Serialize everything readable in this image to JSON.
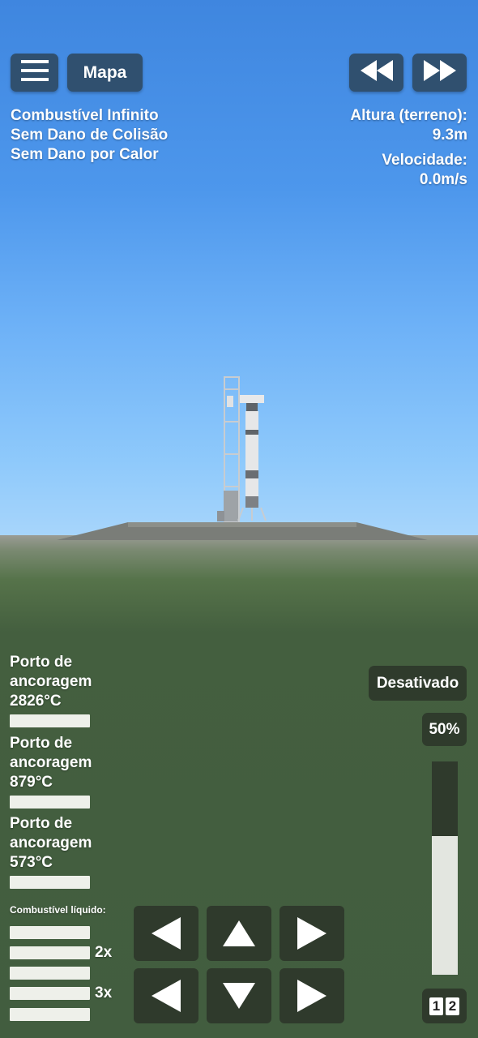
{
  "toolbar": {
    "menu_icon": "hamburger-menu-icon",
    "map_label": "Mapa",
    "rewind_icon": "rewind-icon",
    "fast_forward_icon": "fast-forward-icon"
  },
  "cheats": [
    "Combustível Infinito",
    "Sem Dano de Colisão",
    "Sem Dano por Calor"
  ],
  "telemetry": {
    "altitude_label": "Altura (terreno):",
    "altitude_value": "9.3m",
    "velocity_label": "Velocidade:",
    "velocity_value": "0.0m/s"
  },
  "docking_ports": [
    {
      "line1": "Porto de",
      "line2": "ancoragem",
      "temp": "2826°C"
    },
    {
      "line1": "Porto de",
      "line2": "ancoragem",
      "temp": "879°C"
    },
    {
      "line1": "Porto de",
      "line2": "ancoragem",
      "temp": "573°C"
    }
  ],
  "fuel": {
    "label": "Combustível líquido:",
    "mult_2x": "2x",
    "mult_3x": "3x"
  },
  "throttle": {
    "toggle_label": "Desativado",
    "percent_label": "50%",
    "level": 0.65
  },
  "stage_selector": {
    "one": "1",
    "two": "2"
  },
  "controls": [
    "arrow-left-icon",
    "arrow-up-icon",
    "arrow-right-icon",
    "arrow-left-icon",
    "arrow-down-icon",
    "arrow-right-icon"
  ],
  "colors": {
    "button": "#30506f",
    "panel": "#2f3a2c",
    "ground": "#445f3f"
  }
}
